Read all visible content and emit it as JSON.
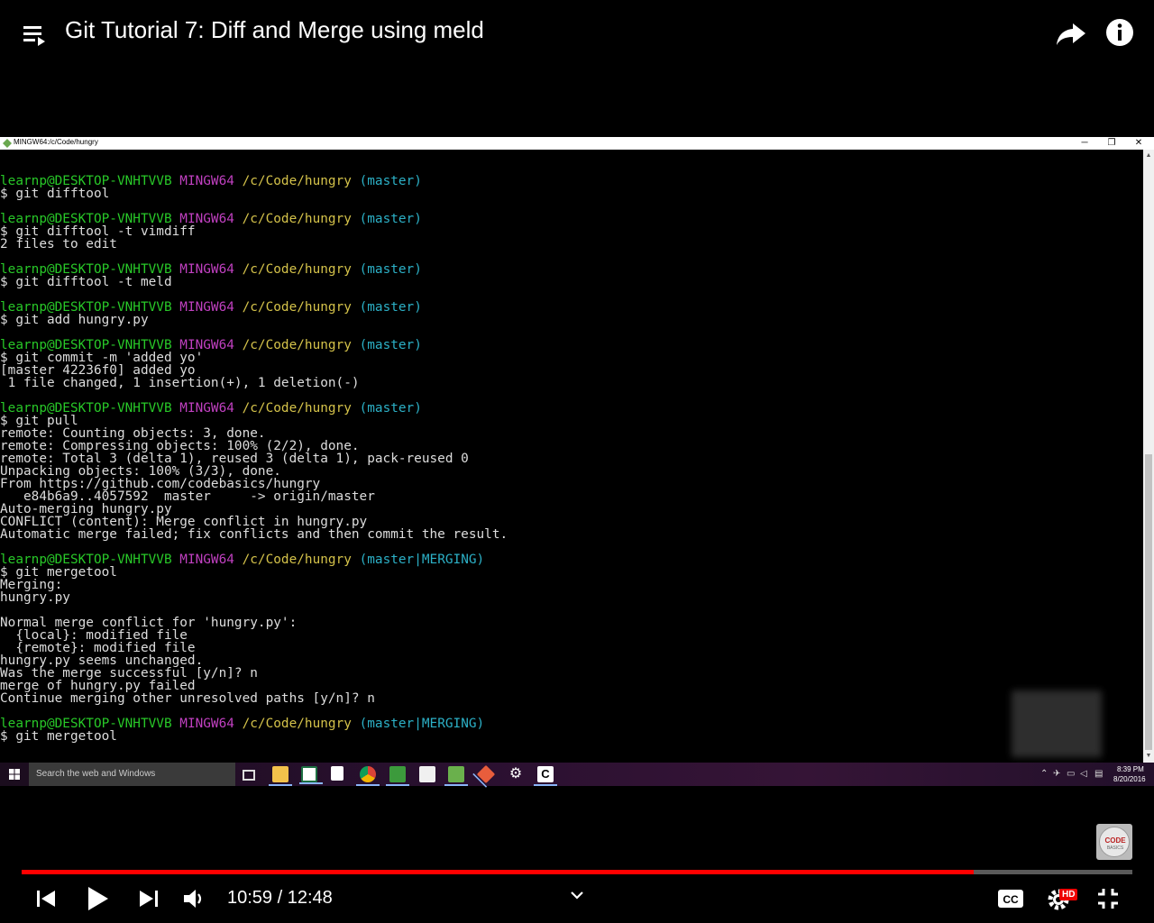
{
  "player": {
    "title": "Git Tutorial 7: Diff and Merge using meld",
    "current_time": "10:59",
    "separator": " / ",
    "duration": "12:48",
    "progress_fraction": 0.857,
    "hd_label": "HD"
  },
  "window": {
    "title": "MINGW64:/c/Code/hungry",
    "minimize_glyph": "─",
    "maximize_glyph": "❐",
    "close_glyph": "✕"
  },
  "terminal": {
    "lines": [
      {
        "type": "blank"
      },
      {
        "type": "prompt",
        "user": "learnp@DESKTOP-VNHTVVB",
        "host": "MINGW64",
        "path": "/c/Code/hungry",
        "branch": "(master)"
      },
      {
        "type": "text",
        "text": "$ git difftool"
      },
      {
        "type": "blank"
      },
      {
        "type": "prompt",
        "user": "learnp@DESKTOP-VNHTVVB",
        "host": "MINGW64",
        "path": "/c/Code/hungry",
        "branch": "(master)"
      },
      {
        "type": "text",
        "text": "$ git difftool -t vimdiff"
      },
      {
        "type": "text",
        "text": "2 files to edit"
      },
      {
        "type": "blank"
      },
      {
        "type": "prompt",
        "user": "learnp@DESKTOP-VNHTVVB",
        "host": "MINGW64",
        "path": "/c/Code/hungry",
        "branch": "(master)"
      },
      {
        "type": "text",
        "text": "$ git difftool -t meld"
      },
      {
        "type": "blank"
      },
      {
        "type": "prompt",
        "user": "learnp@DESKTOP-VNHTVVB",
        "host": "MINGW64",
        "path": "/c/Code/hungry",
        "branch": "(master)"
      },
      {
        "type": "text",
        "text": "$ git add hungry.py"
      },
      {
        "type": "blank"
      },
      {
        "type": "prompt",
        "user": "learnp@DESKTOP-VNHTVVB",
        "host": "MINGW64",
        "path": "/c/Code/hungry",
        "branch": "(master)"
      },
      {
        "type": "text",
        "text": "$ git commit -m 'added yo'"
      },
      {
        "type": "text",
        "text": "[master 42236f0] added yo"
      },
      {
        "type": "text",
        "text": " 1 file changed, 1 insertion(+), 1 deletion(-)"
      },
      {
        "type": "blank"
      },
      {
        "type": "prompt",
        "user": "learnp@DESKTOP-VNHTVVB",
        "host": "MINGW64",
        "path": "/c/Code/hungry",
        "branch": "(master)"
      },
      {
        "type": "text",
        "text": "$ git pull"
      },
      {
        "type": "text",
        "text": "remote: Counting objects: 3, done."
      },
      {
        "type": "text",
        "text": "remote: Compressing objects: 100% (2/2), done."
      },
      {
        "type": "text",
        "text": "remote: Total 3 (delta 1), reused 3 (delta 1), pack-reused 0"
      },
      {
        "type": "text",
        "text": "Unpacking objects: 100% (3/3), done."
      },
      {
        "type": "text",
        "text": "From https://github.com/codebasics/hungry"
      },
      {
        "type": "text",
        "text": "   e84b6a9..4057592  master     -> origin/master"
      },
      {
        "type": "text",
        "text": "Auto-merging hungry.py"
      },
      {
        "type": "text",
        "text": "CONFLICT (content): Merge conflict in hungry.py"
      },
      {
        "type": "text",
        "text": "Automatic merge failed; fix conflicts and then commit the result."
      },
      {
        "type": "blank"
      },
      {
        "type": "prompt",
        "user": "learnp@DESKTOP-VNHTVVB",
        "host": "MINGW64",
        "path": "/c/Code/hungry",
        "branch": "(master|MERGING)"
      },
      {
        "type": "text",
        "text": "$ git mergetool"
      },
      {
        "type": "text",
        "text": "Merging:"
      },
      {
        "type": "text",
        "text": "hungry.py"
      },
      {
        "type": "blank"
      },
      {
        "type": "text",
        "text": "Normal merge conflict for 'hungry.py':"
      },
      {
        "type": "text",
        "text": "  {local}: modified file"
      },
      {
        "type": "text",
        "text": "  {remote}: modified file"
      },
      {
        "type": "text",
        "text": "hungry.py seems unchanged."
      },
      {
        "type": "text",
        "text": "Was the merge successful [y/n]? n"
      },
      {
        "type": "text",
        "text": "merge of hungry.py failed"
      },
      {
        "type": "text",
        "text": "Continue merging other unresolved paths [y/n]? n"
      },
      {
        "type": "blank"
      },
      {
        "type": "prompt",
        "user": "learnp@DESKTOP-VNHTVVB",
        "host": "MINGW64",
        "path": "/c/Code/hungry",
        "branch": "(master|MERGING)"
      },
      {
        "type": "text",
        "text": "$ git mergetool"
      }
    ]
  },
  "taskbar": {
    "search_placeholder": "Search the web and Windows",
    "icons": [
      "task-view-icon",
      "file-explorer-icon",
      "excel-icon",
      "store-icon",
      "chrome-icon",
      "camtasia-icon",
      "file-icon",
      "notepad-icon",
      "git-icon",
      "settings-icon",
      "terminal-icon"
    ],
    "time": "8:39 PM",
    "date": "8/20/2016"
  },
  "channel_logo": {
    "text": "CODE",
    "subtext": "BASICS"
  },
  "colors": {
    "progress": "#ff0000",
    "terminal_user": "#28c828",
    "terminal_host": "#c040c0",
    "terminal_path": "#d4c24a",
    "terminal_branch": "#2cb0c6"
  }
}
